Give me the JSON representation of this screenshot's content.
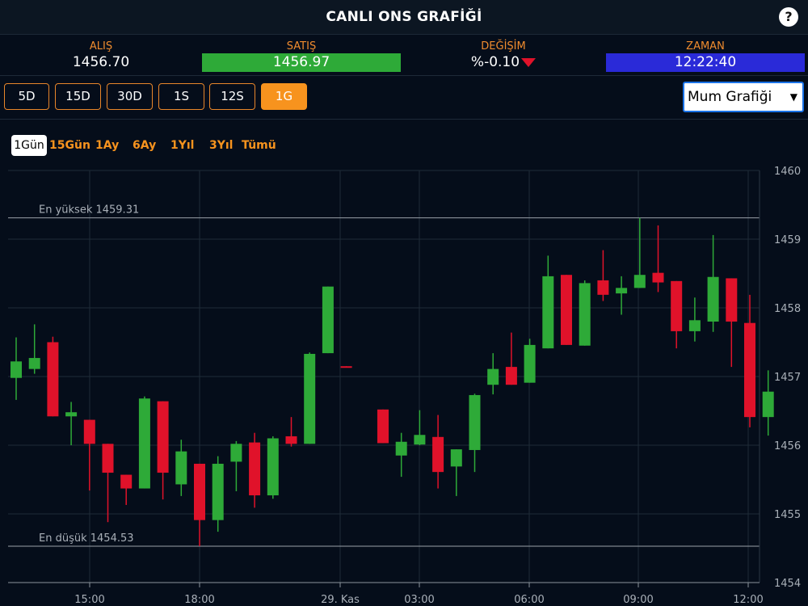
{
  "header": {
    "title": "CANLI ONS GRAFİĞİ",
    "help_label": "?"
  },
  "stats": [
    {
      "label": "ALIŞ",
      "value": "1456.70"
    },
    {
      "label": "SATIŞ",
      "value": "1456.97"
    },
    {
      "label": "DEĞİŞİM",
      "value": "%-0.10"
    },
    {
      "label": "ZAMAN",
      "value": "12:22:40"
    }
  ],
  "colors": {
    "accent": "#f7931e",
    "up": "#2eaa38",
    "down": "#e0122a",
    "time_bg": "#2a2ad8",
    "background": "#050d1a"
  },
  "interval_buttons": [
    "5D",
    "15D",
    "30D",
    "1S",
    "12S",
    "1G"
  ],
  "active_interval": "1G",
  "chart_type_select": {
    "selected": "Mum Grafiği"
  },
  "range_buttons": [
    "1Gün",
    "15Gün",
    "1Ay",
    "6Ay",
    "1Yıl",
    "3Yıl",
    "Tümü"
  ],
  "active_range": "1Gün",
  "chart_data": {
    "type": "candlestick",
    "ylim": [
      1454,
      1460
    ],
    "y_ticks": [
      1460,
      1459,
      1458,
      1457,
      1456,
      1455,
      1454
    ],
    "x_ticks": [
      "15:00",
      "18:00",
      "29. Kas",
      "03:00",
      "06:00",
      "09:00",
      "12:00"
    ],
    "grid": true,
    "annotations": [
      {
        "label": "En yüksek 1459.31",
        "value": 1459.31
      },
      {
        "label": "En düşük 1454.53",
        "value": 1454.53
      }
    ],
    "candles": [
      {
        "o": 1456.98,
        "h": 1457.57,
        "l": 1456.66,
        "c": 1457.22
      },
      {
        "o": 1457.11,
        "h": 1457.76,
        "l": 1457.04,
        "c": 1457.27
      },
      {
        "o": 1457.5,
        "h": 1457.58,
        "l": 1456.42,
        "c": 1456.42
      },
      {
        "o": 1456.42,
        "h": 1456.63,
        "l": 1456.0,
        "c": 1456.48
      },
      {
        "o": 1456.37,
        "h": 1456.37,
        "l": 1455.34,
        "c": 1456.02
      },
      {
        "o": 1456.02,
        "h": 1456.02,
        "l": 1454.88,
        "c": 1455.6
      },
      {
        "o": 1455.57,
        "h": 1455.57,
        "l": 1455.13,
        "c": 1455.37
      },
      {
        "o": 1455.37,
        "h": 1456.71,
        "l": 1455.37,
        "c": 1456.68
      },
      {
        "o": 1456.64,
        "h": 1456.64,
        "l": 1455.21,
        "c": 1455.6
      },
      {
        "o": 1455.43,
        "h": 1456.08,
        "l": 1455.26,
        "c": 1455.91
      },
      {
        "o": 1455.73,
        "h": 1455.73,
        "l": 1454.53,
        "c": 1454.91
      },
      {
        "o": 1454.91,
        "h": 1455.84,
        "l": 1454.74,
        "c": 1455.73
      },
      {
        "o": 1455.76,
        "h": 1456.06,
        "l": 1455.33,
        "c": 1456.02
      },
      {
        "o": 1456.04,
        "h": 1456.18,
        "l": 1455.09,
        "c": 1455.27
      },
      {
        "o": 1455.27,
        "h": 1456.13,
        "l": 1455.22,
        "c": 1456.1
      },
      {
        "o": 1456.13,
        "h": 1456.41,
        "l": 1455.98,
        "c": 1456.02
      },
      {
        "o": 1456.02,
        "h": 1457.35,
        "l": 1456.02,
        "c": 1457.33
      },
      {
        "o": 1457.34,
        "h": 1458.31,
        "l": 1457.34,
        "c": 1458.31
      },
      {
        "o": 1457.15,
        "h": 1457.15,
        "l": 1457.13,
        "c": 1457.14
      },
      null,
      {
        "o": 1456.52,
        "h": 1456.52,
        "l": 1456.03,
        "c": 1456.03
      },
      {
        "o": 1455.85,
        "h": 1456.18,
        "l": 1455.54,
        "c": 1456.05
      },
      {
        "o": 1456.01,
        "h": 1456.51,
        "l": 1456.0,
        "c": 1456.15
      },
      {
        "o": 1456.12,
        "h": 1456.44,
        "l": 1455.37,
        "c": 1455.61
      },
      {
        "o": 1455.69,
        "h": 1455.94,
        "l": 1455.26,
        "c": 1455.94
      },
      {
        "o": 1455.93,
        "h": 1456.75,
        "l": 1455.61,
        "c": 1456.73
      },
      {
        "o": 1456.88,
        "h": 1457.34,
        "l": 1456.74,
        "c": 1457.11
      },
      {
        "o": 1457.14,
        "h": 1457.64,
        "l": 1456.88,
        "c": 1456.88
      },
      {
        "o": 1456.91,
        "h": 1457.55,
        "l": 1456.91,
        "c": 1457.46
      },
      {
        "o": 1457.41,
        "h": 1458.76,
        "l": 1457.41,
        "c": 1458.46
      },
      {
        "o": 1458.48,
        "h": 1458.48,
        "l": 1457.46,
        "c": 1457.46
      },
      {
        "o": 1457.45,
        "h": 1458.4,
        "l": 1457.45,
        "c": 1458.36
      },
      {
        "o": 1458.4,
        "h": 1458.84,
        "l": 1458.1,
        "c": 1458.19
      },
      {
        "o": 1458.21,
        "h": 1458.46,
        "l": 1457.9,
        "c": 1458.29
      },
      {
        "o": 1458.29,
        "h": 1459.31,
        "l": 1458.29,
        "c": 1458.48
      },
      {
        "o": 1458.51,
        "h": 1459.2,
        "l": 1458.23,
        "c": 1458.37
      },
      {
        "o": 1458.39,
        "h": 1458.39,
        "l": 1457.41,
        "c": 1457.66
      },
      {
        "o": 1457.66,
        "h": 1458.15,
        "l": 1457.51,
        "c": 1457.82
      },
      {
        "o": 1457.8,
        "h": 1459.06,
        "l": 1457.65,
        "c": 1458.45
      },
      {
        "o": 1458.43,
        "h": 1458.43,
        "l": 1457.14,
        "c": 1457.8
      },
      {
        "o": 1457.78,
        "h": 1458.19,
        "l": 1456.26,
        "c": 1456.41
      },
      {
        "o": 1456.41,
        "h": 1457.09,
        "l": 1456.14,
        "c": 1456.78
      }
    ]
  }
}
